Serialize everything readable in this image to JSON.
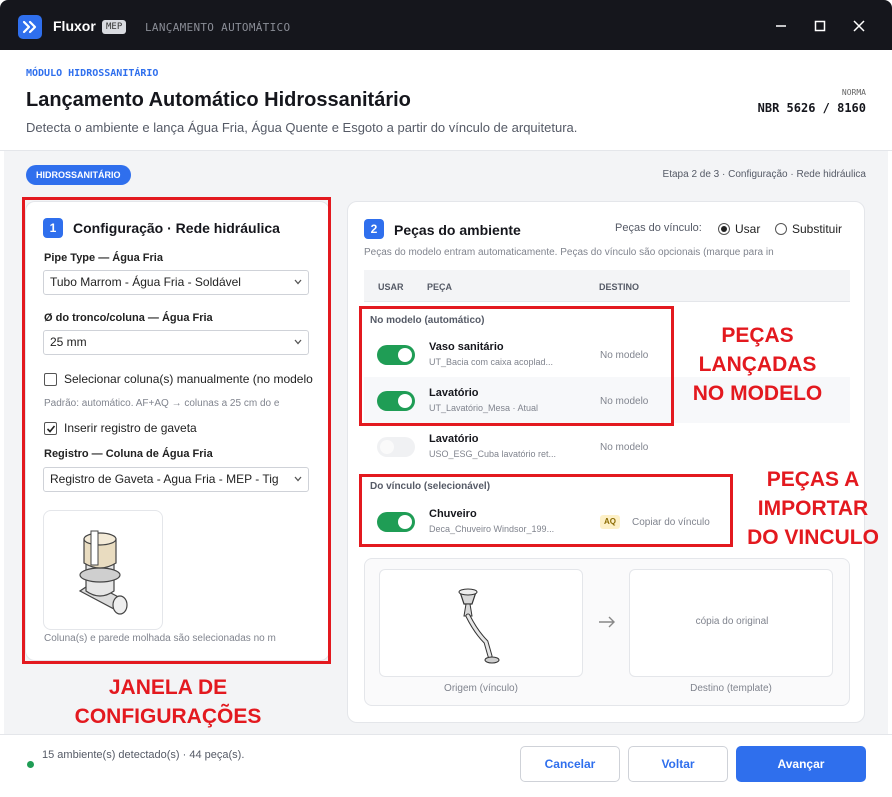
{
  "titlebar": {
    "app_name": "Fluxor",
    "badge": "MEP",
    "subtitle": "LANÇAMENTO AUTOMÁTICO",
    "icons": [
      "logo-icon",
      "minimize-icon",
      "maximize-icon",
      "close-icon"
    ]
  },
  "header": {
    "module_label": "MÓDULO HIDROSSANITÁRIO",
    "title": "Lançamento Automático Hidrossanitário",
    "description": "Detecta o ambiente e lança Água Fria, Água Quente e Esgoto a partir do vínculo de arquitetura.",
    "norma_label": "NORMA",
    "norma_value": "NBR 5626 / 8160"
  },
  "status_bar": {
    "pill": "HIDROSSANITÁRIO",
    "step": "Etapa 2 de 3 · Configuração · Rede hidráulica"
  },
  "config_panel": {
    "number": "1",
    "title": "Configuração · Rede hidráulica",
    "pipe_type_label": "Pipe Type — Água Fria",
    "pipe_type_value": "Tubo Marrom - Água Fria - Soldável",
    "diameter_label": "Ø do tronco/coluna — Água Fria",
    "diameter_value": "25 mm",
    "manual_column_label": "Selecionar coluna(s) manualmente (no modelo",
    "manual_column_checked": false,
    "default_hint": "Padrão: automático. AF+AQ → colunas a 25 cm do e",
    "insert_valve_label": "Inserir registro de gaveta",
    "insert_valve_checked": true,
    "register_label": "Registro — Coluna de Água Fria",
    "register_value": "Registro de Gaveta - Agua Fria - MEP - Tig",
    "footer_hint": "Coluna(s) e parede molhada são selecionadas no m"
  },
  "pieces_panel": {
    "number": "2",
    "title": "Peças do ambiente",
    "link_label": "Peças do vínculo:",
    "options": [
      {
        "label": "Usar",
        "selected": true
      },
      {
        "label": "Substituir",
        "selected": false
      }
    ],
    "description": "Peças do modelo entram automaticamente. Peças do vínculo são opcionais (marque para in",
    "columns": [
      "USAR",
      "PEÇA",
      "DESTINO"
    ],
    "group_model": "No modelo (automático)",
    "group_link": "Do vínculo (selecionável)",
    "rows": [
      {
        "name": "Vaso sanitário",
        "sub": "UT_Bacia com caixa acoplad...",
        "dest": "No modelo",
        "on": true
      },
      {
        "name": "Lavatório",
        "sub": "UT_Lavatório_Mesa  ·  Atual",
        "dest": "No modelo",
        "on": true
      },
      {
        "name": "Lavatório",
        "sub": "USO_ESG_Cuba lavatório ret...",
        "dest": "No modelo",
        "on": false
      },
      {
        "name": "Chuveiro",
        "sub": "Deca_Chuveiro Windsor_199...",
        "badge": "AQ",
        "dest": "Copiar do vínculo",
        "on": true
      }
    ],
    "compare": {
      "target_text": "cópia do original",
      "origin_caption": "Origem (vínculo)",
      "target_caption": "Destino (template)"
    }
  },
  "annotations": {
    "config_window": "JANELA DE\nCONFIGURAÇÕES",
    "model_pieces": "PEÇAS\nLANÇADAS\nNO MODELO",
    "link_pieces": "PEÇAS A\nIMPORTAR\nDO VINCULO",
    "color": "#e3191f"
  },
  "footer": {
    "status": "15 ambiente(s) detectado(s) · 44 peça(s).",
    "cancel": "Cancelar",
    "back": "Voltar",
    "next": "Avançar"
  },
  "colors": {
    "accent": "#2f6fed",
    "toggle_on": "#1f9d55",
    "titlebar": "#15161c",
    "badge_aq": "#fdf0c7"
  }
}
